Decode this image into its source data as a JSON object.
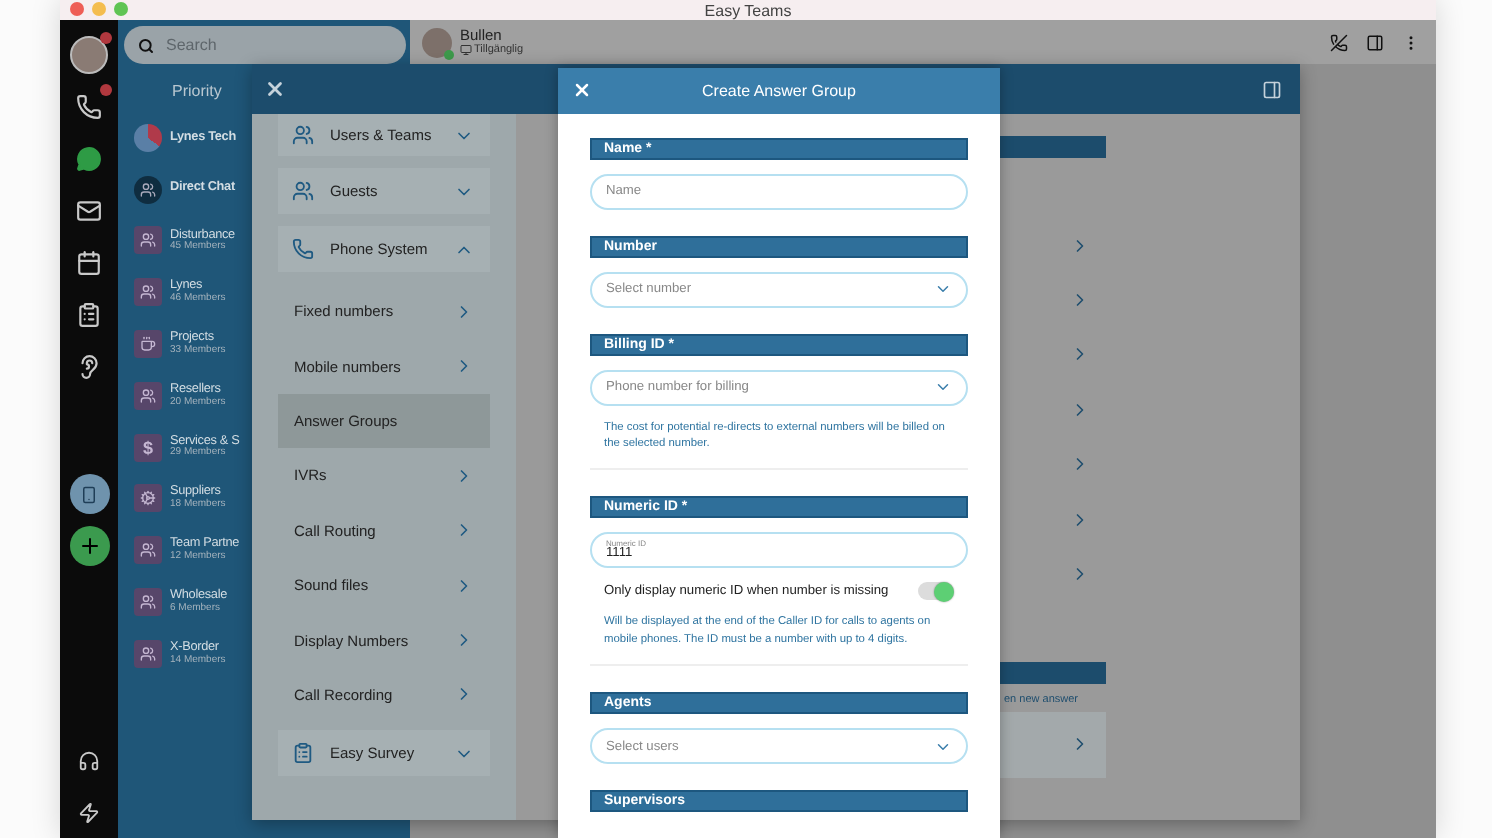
{
  "window": {
    "title": "Easy Teams"
  },
  "search": {
    "placeholder": "Search"
  },
  "rail": {
    "items": [
      {
        "kind": "avatar",
        "badge": true
      },
      {
        "kind": "phone",
        "badge": true
      },
      {
        "kind": "chat",
        "badge": false
      },
      {
        "kind": "mail",
        "badge": false
      },
      {
        "kind": "calendar",
        "badge": false
      },
      {
        "kind": "clipboard",
        "badge": false
      },
      {
        "kind": "ear",
        "badge": false
      },
      {
        "kind": "device",
        "badge": false
      },
      {
        "kind": "add",
        "badge": false
      }
    ],
    "bottom": [
      {
        "kind": "headset"
      },
      {
        "kind": "bolt"
      }
    ]
  },
  "channels": {
    "heading": "Priority",
    "items": [
      {
        "kind": "logo",
        "name": "Lynes Tech"
      },
      {
        "kind": "direct",
        "name": "Direct Chat"
      },
      {
        "kind": "team",
        "name": "Disturbance",
        "members": "45 Members"
      },
      {
        "kind": "team",
        "name": "Lynes",
        "members": "46 Members"
      },
      {
        "kind": "cup",
        "name": "Projects",
        "members": "33 Members"
      },
      {
        "kind": "team",
        "name": "Resellers",
        "members": "20 Members"
      },
      {
        "kind": "glyph",
        "glyph": "$",
        "name": "Services & S",
        "members": "29 Members"
      },
      {
        "kind": "gears",
        "name": "Suppliers",
        "members": "18 Members"
      },
      {
        "kind": "team",
        "name": "Team Partne",
        "members": "12 Members"
      },
      {
        "kind": "team",
        "name": "Wholesale",
        "members": "6 Members"
      },
      {
        "kind": "team",
        "name": "X-Border",
        "members": "14 Members"
      }
    ]
  },
  "chat_header": {
    "name": "Bullen",
    "status": "Tillgänglig"
  },
  "settings": {
    "menu": [
      {
        "label": "Users & Teams",
        "kind": "users",
        "expanded": false
      },
      {
        "label": "Guests",
        "kind": "users",
        "expanded": false
      },
      {
        "label": "Phone System",
        "kind": "phone",
        "expanded": true,
        "children": [
          {
            "label": "Fixed numbers",
            "selected": false
          },
          {
            "label": "Mobile numbers",
            "selected": false
          },
          {
            "label": "Answer Groups",
            "selected": true
          },
          {
            "label": "IVRs",
            "selected": false
          },
          {
            "label": "Call Routing",
            "selected": false
          },
          {
            "label": "Sound files",
            "selected": false
          },
          {
            "label": "Display Numbers",
            "selected": false
          },
          {
            "label": "Call Recording",
            "selected": false
          }
        ]
      },
      {
        "label": "Easy Survey",
        "kind": "clipboard",
        "expanded": false
      }
    ],
    "background_note": "en new answer"
  },
  "dialog": {
    "title": "Create Answer Group",
    "sections": [
      {
        "title": "Name *",
        "field": {
          "kind": "text",
          "placeholder": "Name"
        }
      },
      {
        "title": "Number",
        "field": {
          "kind": "select",
          "placeholder": "Select number"
        }
      },
      {
        "title": "Billing ID *",
        "field": {
          "kind": "select",
          "placeholder": "Phone number for billing"
        },
        "hint": "The cost for potential re-directs to external numbers will be billed on the selected number."
      },
      {
        "title": "Numeric ID *",
        "field": {
          "kind": "text",
          "label": "Numeric ID",
          "value": "1111"
        },
        "toggle": {
          "label": "Only display numeric ID when number is missing",
          "on": true
        },
        "hint": "Will be displayed at the end of the Caller ID for calls to agents on mobile phones. The ID must be a number with up to 4 digits."
      },
      {
        "title": "Agents",
        "field": {
          "kind": "select",
          "placeholder": "Select users"
        }
      },
      {
        "title": "Supervisors"
      }
    ]
  }
}
